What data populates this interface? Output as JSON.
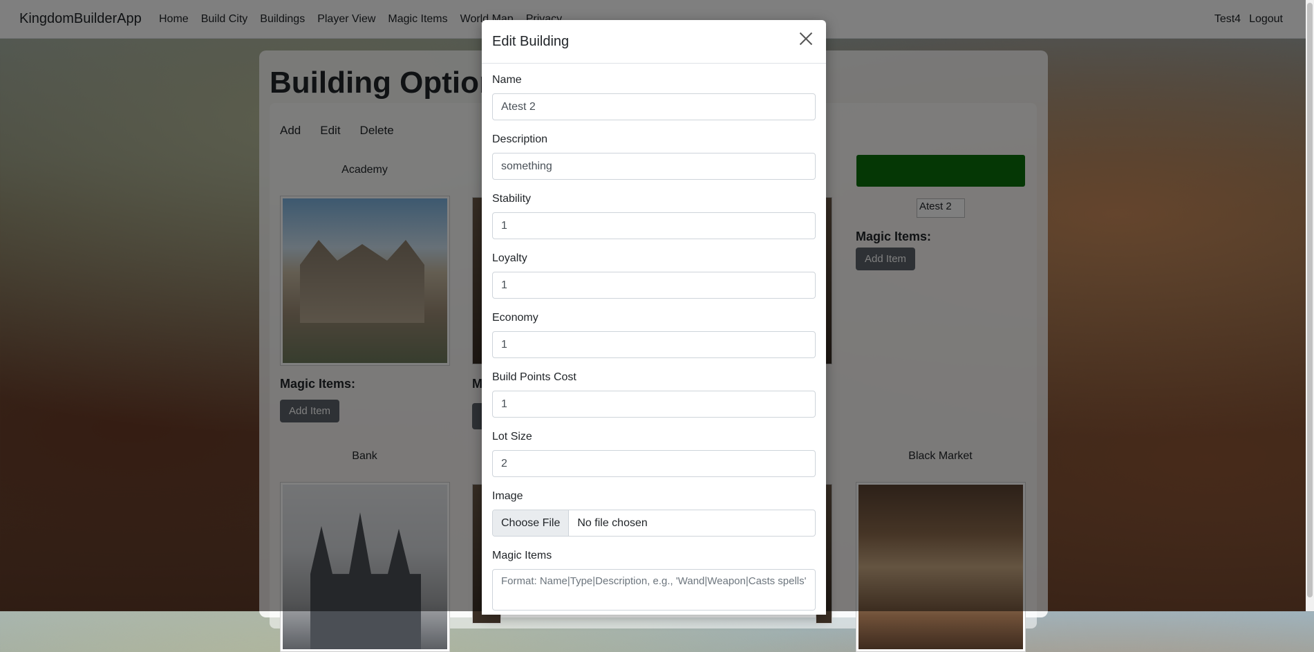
{
  "navbar": {
    "brand": "KingdomBuilderApp",
    "links": [
      "Home",
      "Build City",
      "Buildings",
      "Player View",
      "Magic Items",
      "World Map",
      "Privacy"
    ],
    "user": "Test4",
    "logout": "Logout"
  },
  "page": {
    "title": "Building Options",
    "actions": [
      "Add",
      "Edit",
      "Delete"
    ]
  },
  "cards": [
    {
      "title": "Academy",
      "magic_label": "Magic Items:",
      "add_button": "Add Item"
    },
    {
      "title": "Bank"
    },
    {
      "title": "Black Market"
    }
  ],
  "card_extra": {
    "partial_magic_letter": "M",
    "atest_alt": "Atest 2",
    "magic_label": "Magic Items:",
    "add_button": "Add Item"
  },
  "modal": {
    "title": "Edit Building",
    "fields": {
      "name": {
        "label": "Name",
        "value": "Atest 2"
      },
      "description": {
        "label": "Description",
        "value": "something"
      },
      "stability": {
        "label": "Stability",
        "value": "1"
      },
      "loyalty": {
        "label": "Loyalty",
        "value": "1"
      },
      "economy": {
        "label": "Economy",
        "value": "1"
      },
      "build_points_cost": {
        "label": "Build Points Cost",
        "value": "1"
      },
      "lot_size": {
        "label": "Lot Size",
        "value": "2"
      },
      "image": {
        "label": "Image",
        "button": "Choose File",
        "status": "No file chosen"
      },
      "magic_items": {
        "label": "Magic Items",
        "placeholder": "Format: Name|Type|Description, e.g., 'Wand|Weapon|Casts spells'"
      }
    }
  },
  "colors": {
    "accent_green": "#0a6e0a",
    "button_gray": "#5c636a"
  }
}
